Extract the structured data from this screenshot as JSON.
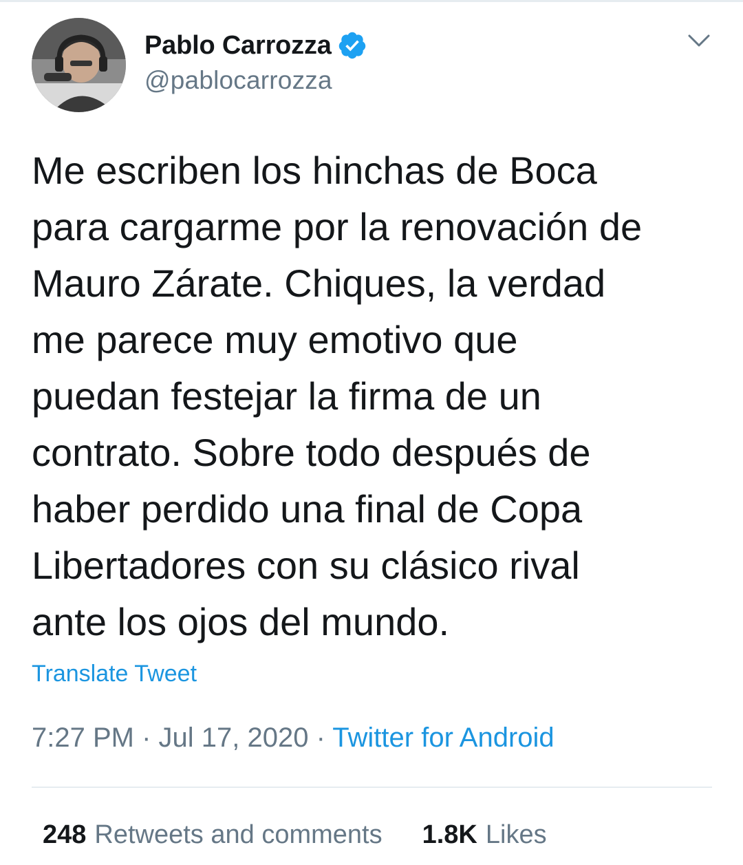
{
  "author": {
    "display_name": "Pablo Carrozza",
    "handle": "@pablocarrozza",
    "verified": true
  },
  "tweet": {
    "text": "Me escriben los hinchas de Boca\npara cargarme por la renovación de\nMauro Zárate. Chiques, la verdad\nme parece muy emotivo que\npuedan festejar la firma de un\ncontrato. Sobre todo después de\nhaber perdido una final de Copa\nLibertadores con su clásico rival\nante los ojos del mundo.",
    "translate_label": "Translate Tweet",
    "time": "7:27 PM",
    "separator_1": " · ",
    "date": "Jul 17, 2020",
    "separator_2": " · ",
    "source": "Twitter for Android"
  },
  "stats": {
    "retweets_count": "248",
    "retweets_label": "Retweets and comments",
    "likes_count": "1.8K",
    "likes_label": "Likes"
  },
  "colors": {
    "text_primary": "#14171a",
    "text_secondary": "#657786",
    "link_blue": "#1b95e0",
    "verified_blue": "#1da1f2",
    "divider": "#e6ecf0"
  },
  "icons": {
    "verified": "verified-badge-icon",
    "caret": "chevron-down-icon"
  }
}
